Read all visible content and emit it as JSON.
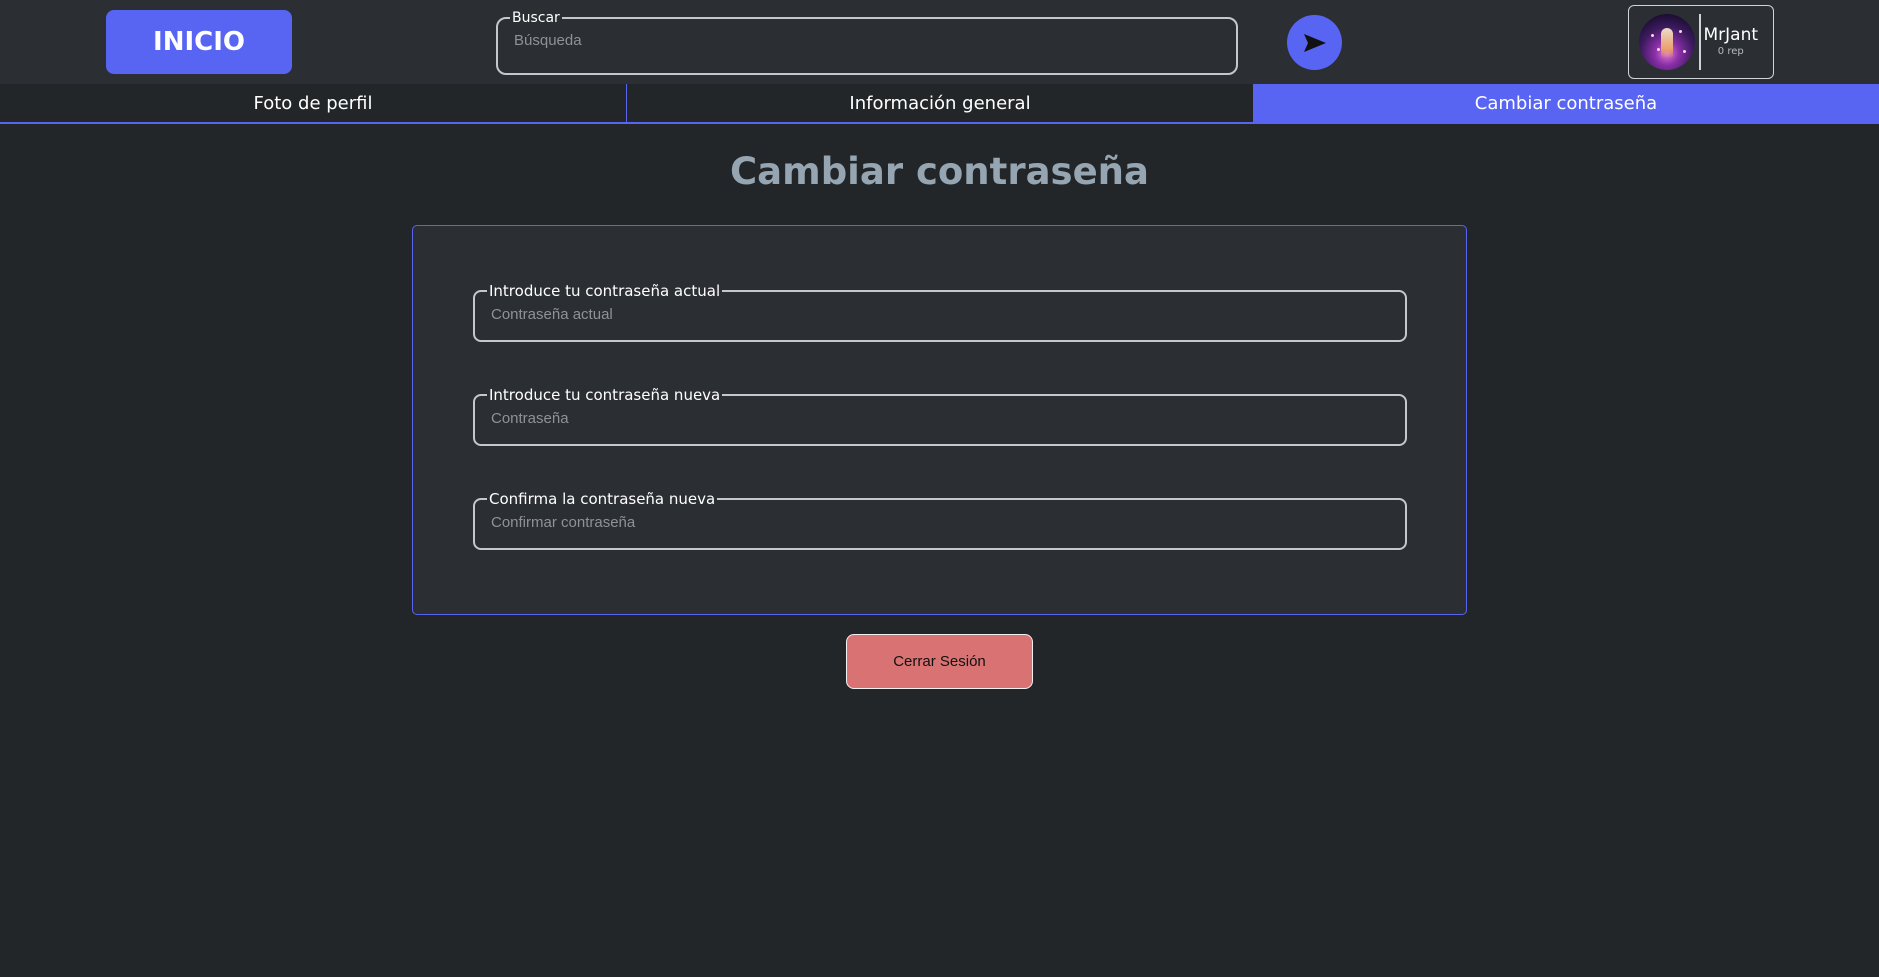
{
  "header": {
    "home_label": "INICIO",
    "search": {
      "legend": "Buscar",
      "placeholder": "Búsqueda",
      "value": ""
    },
    "send_icon": "send-arrow-icon",
    "profile": {
      "username": "MrJant",
      "reputation": "0 rep",
      "avatar_icon": "avatar-image"
    }
  },
  "tabs": [
    {
      "label": "Foto de perfil",
      "active": false
    },
    {
      "label": "Información general",
      "active": false
    },
    {
      "label": "Cambiar contraseña",
      "active": true
    }
  ],
  "main": {
    "title": "Cambiar contraseña",
    "fields": [
      {
        "legend": "Introduce tu contraseña actual",
        "placeholder": "Contraseña actual",
        "value": ""
      },
      {
        "legend": "Introduce tu contraseña nueva",
        "placeholder": "Contraseña",
        "value": ""
      },
      {
        "legend": "Confirma la contraseña nueva",
        "placeholder": "Confirmar contraseña",
        "value": ""
      }
    ],
    "logout_label": "Cerrar Sesión"
  },
  "colors": {
    "background": "#232629",
    "surface": "#2b2e33",
    "accent": "#5865f2",
    "title": "#95a5b1",
    "danger": "#d97373"
  }
}
